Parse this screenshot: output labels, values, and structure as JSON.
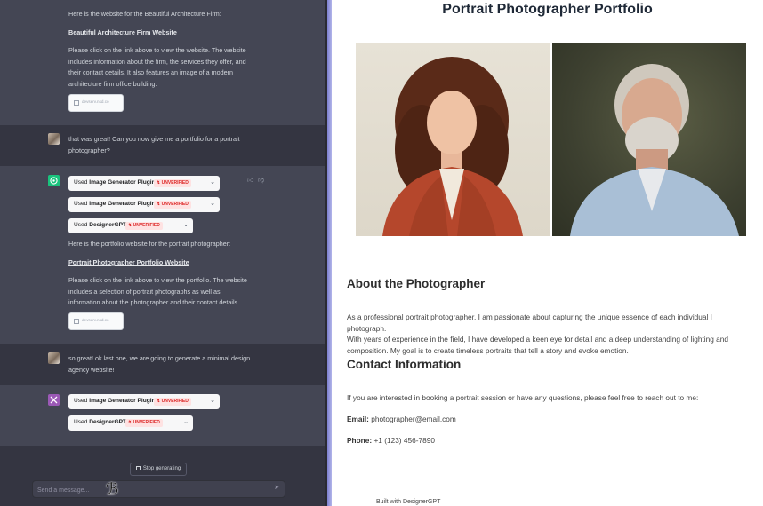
{
  "chat": {
    "assistant_intro_1": "Here is the website for the Beautiful Architecture Firm:",
    "link_1": "Beautiful Architecture Firm Website",
    "desc_1": [
      "Please click on the link above to view the website. The website",
      "includes information about the firm, the services they offer, and",
      "their contact details. It also features an image of a modern",
      "architecture firm office building."
    ],
    "thumb_label": "devserv.nsd.co",
    "user_msg_1": [
      "that was great! Can you now give me a portfolio for a portrait",
      "photographer?"
    ],
    "plugin_used_prefix": "Used",
    "plugins_2": [
      {
        "name": "Image Generator Plugin",
        "badge": "UNVERIFIED"
      },
      {
        "name": "Image Generator Plugin",
        "badge": "UNVERIFIED"
      },
      {
        "name": "DesignerGPT",
        "badge": "UNVERIFIED"
      }
    ],
    "assistant_intro_2": "Here is the portfolio website for the portrait photographer:",
    "link_2": "Portrait Photographer Portfolio Website",
    "desc_2": [
      "Please click on the link above to view the portfolio. The website",
      "includes a selection of portrait photographs as well as",
      "information about the photographer and their contact details."
    ],
    "user_msg_2": [
      "so great! ok last one, we are going to generate a minimal design",
      "agency website!"
    ],
    "plugins_3": [
      {
        "name": "Image Generator Plugin",
        "badge": "UNVERIFIED"
      },
      {
        "name": "DesignerGPT",
        "badge": "UNVERIFIED"
      }
    ],
    "stop_label": "Stop generating",
    "composer_placeholder": "Send a message..."
  },
  "site": {
    "title": "Portrait Photographer Portfolio",
    "about_heading": "About the Photographer",
    "about_text": [
      "As a professional portrait photographer, I am passionate about capturing the unique essence of each individual I photograph.",
      "With years of experience in the field, I have developed a keen eye for detail and a deep understanding of lighting and",
      "composition. My goal is to create timeless portraits that tell a story and evoke emotion."
    ],
    "contact_heading": "Contact Information",
    "contact_intro": "If you are interested in booking a portrait session or have any questions, please feel free to reach out to me:",
    "email_label": "Email:",
    "email_value": "photographer@email.com",
    "phone_label": "Phone:",
    "phone_value": "+1 (123) 456-7890",
    "footer": "Built with DesignerGPT"
  },
  "colors": {
    "chat_bg": "#343541",
    "assistant_bg": "#444654",
    "badge_red": "#dc2626",
    "divider": "#8b8ee0"
  }
}
